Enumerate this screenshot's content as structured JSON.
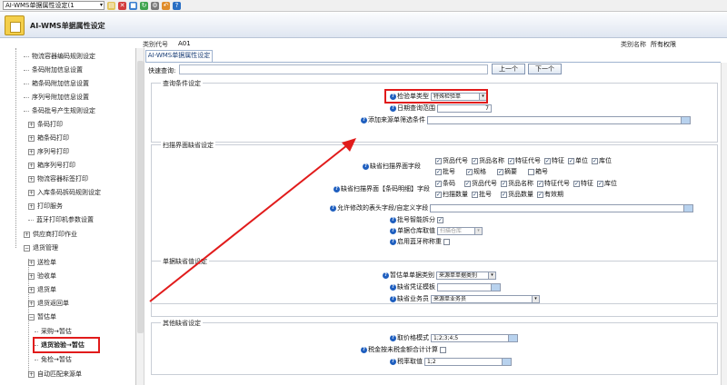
{
  "toolbar": {
    "window_select": "AI-WMS单据属性设定(1",
    "icons": [
      "paste-icon",
      "close-red-icon",
      "save-icon",
      "refresh-icon",
      "settings-icon",
      "undo-icon",
      "help-icon"
    ]
  },
  "banner": {
    "title": "AI-WMS单据属性设定"
  },
  "header": {
    "category_code_label": "类别代号",
    "category_code_value": "A01",
    "category_name_label": "类别名称",
    "category_name_value": "所有权限"
  },
  "sidebar": {
    "items": [
      {
        "label": "物流容器编码规则设定"
      },
      {
        "label": "条码附加信息设置"
      },
      {
        "label": "箱条码附加信息设置"
      },
      {
        "label": "序列号附加信息设置"
      },
      {
        "label": "条码批号产生规则设定"
      },
      {
        "label": "条码打印"
      },
      {
        "label": "箱条码打印"
      },
      {
        "label": "序列号打印"
      },
      {
        "label": "箱序列号打印"
      },
      {
        "label": "物流容器标签打印"
      },
      {
        "label": "入库条码拆码规则设定"
      },
      {
        "label": "打印服务"
      },
      {
        "label": "蓝牙打印机参数设置"
      },
      {
        "label": "供应商打印作业"
      },
      {
        "label": "退货管理"
      },
      {
        "label": "送检单"
      },
      {
        "label": "验收单"
      },
      {
        "label": "退货单"
      },
      {
        "label": "退货返回单"
      },
      {
        "label": "暂估单"
      },
      {
        "label": "采购→暂估"
      },
      {
        "label": "退货验验→暂估"
      },
      {
        "label": "免检→暂估"
      },
      {
        "label": "自动匹配来源单"
      }
    ]
  },
  "tab": {
    "label": "AI-WMS单据属性设定"
  },
  "quick_query": {
    "label": "快速查询:",
    "prev": "上一个",
    "next": "下一个"
  },
  "query_section": {
    "title": "查询条件设定",
    "doc_type_label": "检验单类型",
    "doc_type_value": "特殊检验单",
    "date_range_label": "日期查询范围",
    "date_range_value": "7",
    "filter_label": "添加来源单筛选条件"
  },
  "scan_section": {
    "title": "扫描界面缺省设定",
    "default_fields_label": "缺省扫描界面字段",
    "default_fields_row1": [
      "货品代号",
      "货品名称",
      "特征代号",
      "特征",
      "单位",
      "库位"
    ],
    "default_fields_row2": [
      "批号",
      "规格",
      "摘要",
      "箱号"
    ],
    "default_fields_row2_checked": [
      true,
      true,
      true,
      false
    ],
    "barcode_detail_label": "缺省扫描界面【条码明细】字段",
    "barcode_detail_row1": [
      "条码",
      "货品代号",
      "货品名称",
      "特征代号",
      "特征",
      "库位"
    ],
    "barcode_detail_row2": [
      "扫描数量",
      "批号",
      "货品数量",
      "有效期"
    ],
    "custom_fields_label": "允许修改的表头字段/自定义字段",
    "batch_split_label": "批号智能拆分",
    "single_wh_label": "单据仓库取值",
    "single_wh_value": "扫描仓库",
    "bluetooth_label": "启用蓝牙称称重"
  },
  "doc_default_section": {
    "title": "单据缺省值设定",
    "source_type_label": "暂估单单据类别",
    "source_type_value": "来源单单据类别",
    "voucher_label": "缺省凭证模板",
    "salesman_label": "缺省业务员",
    "salesman_value": "来源单业务员"
  },
  "other_section": {
    "title": "其他缺省设定",
    "price_mode_label": "取价格模式",
    "price_mode_value": "1;2;3;4;5",
    "tax_exclude_label": "税金按未税金额合计计算",
    "tax_rate_label": "税率取值",
    "tax_rate_value": "1;2"
  },
  "colors": {
    "highlight": "#e11b1b",
    "help_icon": "#1f5fbf",
    "tab_text": "#1b3f77"
  }
}
